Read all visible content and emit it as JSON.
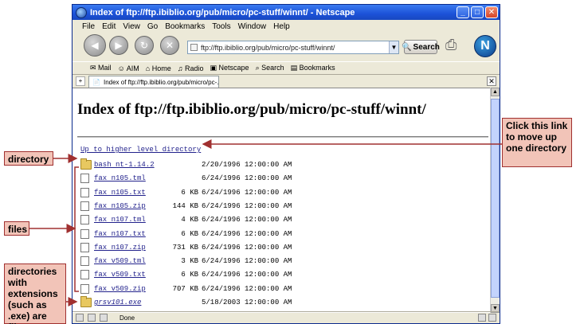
{
  "window": {
    "title": "Index of ftp://ftp.ibiblio.org/pub/micro/pc-stuff/winnt/ - Netscape",
    "controls": [
      "_",
      "□",
      "✕"
    ]
  },
  "menu": [
    "File",
    "Edit",
    "View",
    "Go",
    "Bookmarks",
    "Tools",
    "Window",
    "Help"
  ],
  "navbar": {
    "url": "ftp://ftp.ibiblio.org/pub/micro/pc-stuff/winnt/",
    "search_label": "Search",
    "throbber_letter": "N"
  },
  "personal_toolbar": [
    "Mail",
    "AIM",
    "Home",
    "Radio",
    "Netscape",
    "Search",
    "Bookmarks"
  ],
  "tab": {
    "label": "Index of ftp://ftp.ibiblio.org/pub/micro/pc-..."
  },
  "page": {
    "title": "Index of ftp://ftp.ibiblio.org/pub/micro/pc-stuff/winnt/",
    "up_link": "Up to higher level directory",
    "entries": [
      {
        "name": "bash nt-1.14.2",
        "size": "",
        "date": "2/20/1996 12:00:00 AM",
        "kind": "folder",
        "italic": false
      },
      {
        "name": "fax n105.tml",
        "size": "",
        "date": "6/24/1996 12:00:00 AM",
        "kind": "file",
        "italic": false
      },
      {
        "name": "fax n105.txt",
        "size": "6 KB",
        "date": "6/24/1996 12:00:00 AM",
        "kind": "file",
        "italic": false
      },
      {
        "name": "fax n105.zip",
        "size": "144 KB",
        "date": "6/24/1996 12:00:00 AM",
        "kind": "file",
        "italic": false
      },
      {
        "name": "fax n107.tml",
        "size": "4 KB",
        "date": "6/24/1996 12:00:00 AM",
        "kind": "file",
        "italic": false
      },
      {
        "name": "fax n107.txt",
        "size": "6 KB",
        "date": "6/24/1996 12:00:00 AM",
        "kind": "file",
        "italic": false
      },
      {
        "name": "fax n107.zip",
        "size": "731 KB",
        "date": "6/24/1996 12:00:00 AM",
        "kind": "file",
        "italic": false
      },
      {
        "name": "fax v509.tml",
        "size": "3 KB",
        "date": "6/24/1996 12:00:00 AM",
        "kind": "file",
        "italic": false
      },
      {
        "name": "fax v509.txt",
        "size": "6 KB",
        "date": "6/24/1996 12:00:00 AM",
        "kind": "file",
        "italic": false
      },
      {
        "name": "fax v509.zip",
        "size": "707 KB",
        "date": "6/24/1996 12:00:00 AM",
        "kind": "file",
        "italic": false
      },
      {
        "name": "grsv101.exe",
        "size": "",
        "date": "5/18/2003 12:00:00 AM",
        "kind": "folder",
        "italic": true
      }
    ]
  },
  "status": {
    "text": "Done"
  },
  "callouts": {
    "directory": "directory",
    "files": "files",
    "extensions": "directories with extensions (such as .exe) are files",
    "click": "Click this link to move up one directory"
  },
  "colors": {
    "callout_fill": "#f2c4b8",
    "callout_line": "#a03030",
    "link": "#22228c",
    "titlebar": "#1c52d8"
  }
}
